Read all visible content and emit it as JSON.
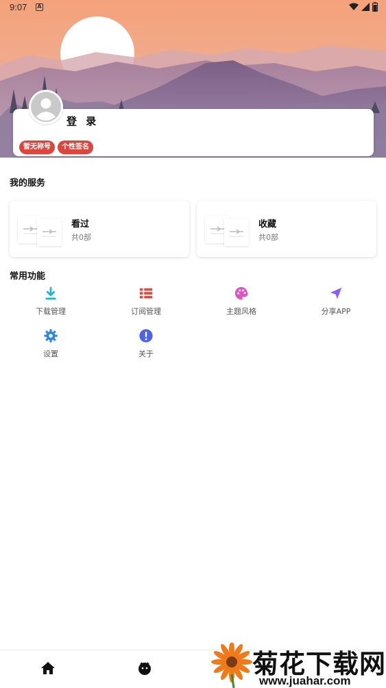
{
  "status_bar": {
    "time": "9:07",
    "icons": [
      "notification-a-icon",
      "wifi-icon",
      "signal-icon",
      "battery-icon"
    ]
  },
  "profile": {
    "login_label": "登 录",
    "tags": [
      "暂无称号",
      "个性签名"
    ]
  },
  "services": {
    "title": "我的服务",
    "items": [
      {
        "label": "看过",
        "count": "共0部"
      },
      {
        "label": "收藏",
        "count": "共0部"
      }
    ]
  },
  "common": {
    "title": "常用功能",
    "items": [
      {
        "label": "下载管理",
        "icon": "download-icon",
        "color": "#1fb8c9"
      },
      {
        "label": "订阅管理",
        "icon": "list-icon",
        "color": "#e04a3f"
      },
      {
        "label": "主题风格",
        "icon": "palette-icon",
        "color": "#e052c8"
      },
      {
        "label": "分享APP",
        "icon": "send-icon",
        "color": "#8b5cf6"
      },
      {
        "label": "设置",
        "icon": "gear-icon",
        "color": "#2f86e0"
      },
      {
        "label": "关于",
        "icon": "info-icon",
        "color": "#4f63e6"
      }
    ]
  },
  "bottom_nav": {
    "items": [
      {
        "icon": "home-icon"
      },
      {
        "icon": "discover-icon"
      }
    ]
  },
  "watermark": {
    "title": "菊花下载网",
    "url": "www.juahar.com"
  }
}
